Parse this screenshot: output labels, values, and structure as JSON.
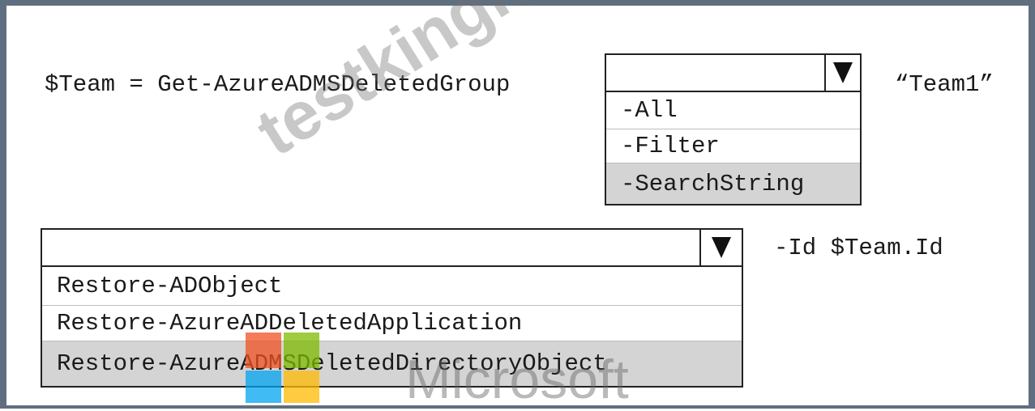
{
  "line1": {
    "prefix": "$Team = Get-AzureADMSDeletedGroup",
    "suffix": "“Team1”",
    "dropdown": {
      "selected": "",
      "options": [
        "-All",
        "-Filter",
        "-SearchString"
      ]
    }
  },
  "line2": {
    "suffix": "-Id $Team.Id",
    "dropdown": {
      "selected": "",
      "options": [
        "Restore-ADObject",
        "Restore-AzureADDeletedApplication",
        "Restore-AzureADMSDeletedDirectoryObject"
      ]
    }
  },
  "watermark": {
    "text": "testkingit.com",
    "logo_text": "Microsoft",
    "logo_colors": [
      "#f25022",
      "#7fba00",
      "#00a4ef",
      "#ffb900"
    ]
  }
}
